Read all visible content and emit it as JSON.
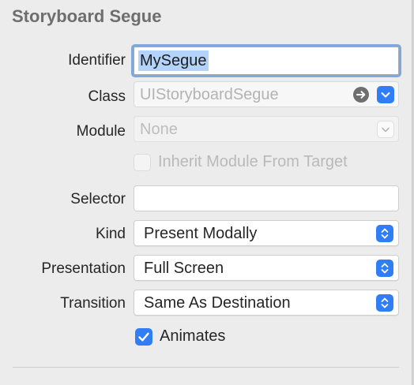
{
  "panel": {
    "title": "Storyboard Segue"
  },
  "identifier": {
    "label": "Identifier",
    "value": "MySegue"
  },
  "class_field": {
    "label": "Class",
    "placeholder": "UIStoryboardSegue",
    "navigate_icon": "arrow-right-circle-icon",
    "dropdown_icon": "chevron-down-icon"
  },
  "module_field": {
    "label": "Module",
    "placeholder": "None",
    "enabled": false
  },
  "inherit_module": {
    "label": "Inherit Module From Target",
    "checked": false,
    "enabled": false
  },
  "selector": {
    "label": "Selector",
    "value": ""
  },
  "kind": {
    "label": "Kind",
    "value": "Present Modally"
  },
  "presentation": {
    "label": "Presentation",
    "value": "Full Screen"
  },
  "transition": {
    "label": "Transition",
    "value": "Same As Destination"
  },
  "animates": {
    "label": "Animates",
    "checked": true
  },
  "colors": {
    "accent": "#2f7ef6",
    "selection": "#b3d3fb",
    "focus_ring": "#7fa9dd",
    "panel_background": "#ececec"
  }
}
